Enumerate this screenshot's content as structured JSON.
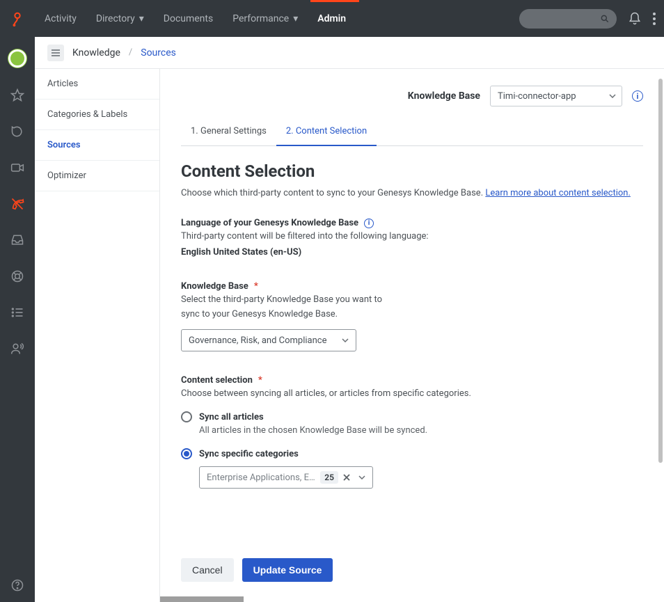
{
  "nav": {
    "items": [
      {
        "label": "Activity"
      },
      {
        "label": "Directory",
        "dropdown": true
      },
      {
        "label": "Documents"
      },
      {
        "label": "Performance",
        "dropdown": true
      },
      {
        "label": "Admin",
        "active": true
      }
    ]
  },
  "breadcrumbs": {
    "parent": "Knowledge",
    "current": "Sources"
  },
  "sidemenu": [
    {
      "label": "Articles"
    },
    {
      "label": "Categories & Labels"
    },
    {
      "label": "Sources",
      "active": true
    },
    {
      "label": "Optimizer"
    }
  ],
  "kb_selector": {
    "label": "Knowledge Base",
    "value": "Timi-connector-app"
  },
  "tabs": [
    {
      "label": "1. General Settings"
    },
    {
      "label": "2. Content Selection",
      "active": true
    }
  ],
  "page": {
    "title": "Content Selection",
    "intro": "Choose which third-party content to sync to your Genesys Knowledge Base. ",
    "intro_link": "Learn more about content selection.",
    "lang_section_label": "Language of your Genesys Knowledge Base",
    "lang_help": "Third-party content will be filtered into the following language:",
    "lang_value": "English United States (en-US)",
    "kb_section_label": "Knowledge Base",
    "kb_help1": "Select the third-party Knowledge Base you want to",
    "kb_help2": "sync to your Genesys Knowledge Base.",
    "kb_value": "Governance, Risk, and Compliance",
    "cs_label": "Content selection",
    "cs_help": "Choose between syncing all articles, or articles from specific categories.",
    "radio_all_label": "Sync all articles",
    "radio_all_desc": "All articles in the chosen Knowledge Base will be synced.",
    "radio_cat_label": "Sync specific categories",
    "multi_text": "Enterprise Applications, Enterpris…",
    "multi_count": "25",
    "cancel": "Cancel",
    "update": "Update Source"
  }
}
